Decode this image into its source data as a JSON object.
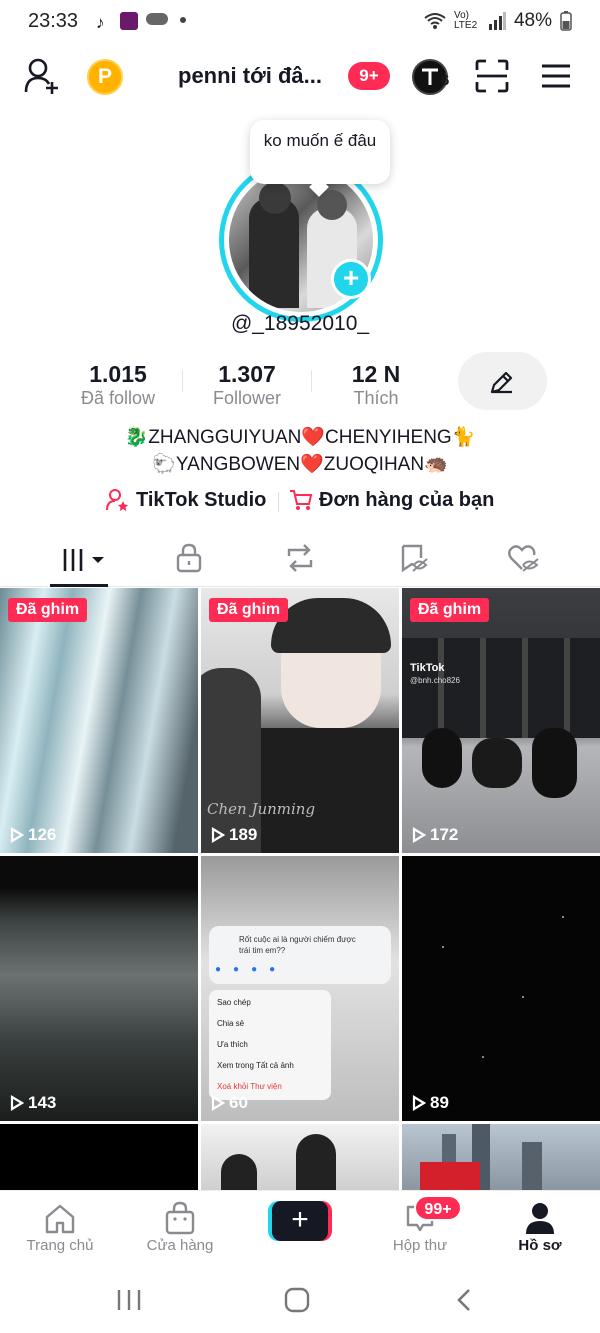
{
  "status_bar": {
    "time": "23:33",
    "network": "Vo) LTE2",
    "battery": "48%"
  },
  "header": {
    "title": "penni tới đâ...",
    "notification_badge": "9+",
    "brand_badge": "6",
    "coin_letter": "P"
  },
  "profile": {
    "bubble_text": "ko muốn ế đâu",
    "username": "@_18952010_",
    "stats": [
      {
        "value": "1.015",
        "label": "Đã follow"
      },
      {
        "value": "1.307",
        "label": "Follower"
      },
      {
        "value": "12 N",
        "label": "Thích"
      }
    ],
    "bio_line1": "🐉ZHANGGUIYUAN❤️CHENYIHENG🐈",
    "bio_line2": "🐑YANGBOWEN❤️ZUOQIHAN🦔",
    "studio_link": "TikTok Studio",
    "orders_link": "Đơn hàng của bạn"
  },
  "videos": [
    {
      "pinned": "Đã ghim",
      "views": "126"
    },
    {
      "pinned": "Đã ghim",
      "views": "189",
      "overlay_text": "Chen Junming"
    },
    {
      "pinned": "Đã ghim",
      "views": "172",
      "watermark": "TikTok",
      "watermark_handle": "@bnh.cho826"
    },
    {
      "views": "143"
    },
    {
      "views": "60",
      "chat_text": "Rốt cuộc ai là người chiếm được trái tim em??",
      "menu": [
        "Sao chép",
        "Chia sẻ",
        "Ưa thích",
        "Xem trong Tất cả ảnh",
        "Xoá khỏi Thư viện"
      ]
    },
    {
      "views": "89"
    }
  ],
  "bottom_nav": {
    "home": "Trang chủ",
    "shop": "Cửa hàng",
    "inbox": "Hộp thư",
    "inbox_badge": "99+",
    "profile": "Hồ sơ"
  },
  "colors": {
    "accent": "#fe2c55",
    "ring": "#20d5ec"
  }
}
